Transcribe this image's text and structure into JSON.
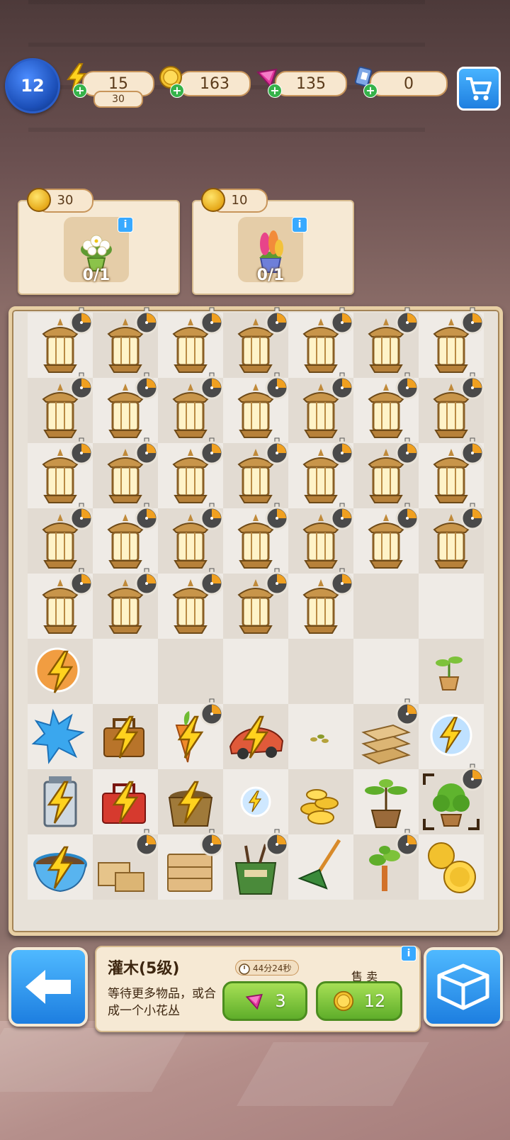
{
  "top_bar": {
    "level": "12",
    "energy": {
      "value": "15",
      "max": "30"
    },
    "coins": "163",
    "gems": "135",
    "cards": "0",
    "plus_symbol": "+",
    "shop_icon": "cart-icon"
  },
  "orders": [
    {
      "reward": "30",
      "item_icon": "white-flower-pot-icon",
      "progress": "0/1",
      "info": "i"
    },
    {
      "reward": "10",
      "item_icon": "hyacinth-pot-icon",
      "progress": "0/1",
      "info": "i"
    }
  ],
  "board": {
    "columns": 7,
    "rows": 9,
    "lantern_rows": [
      7,
      7,
      7,
      7,
      5
    ],
    "row6": [
      {
        "col": 0,
        "icon": "energy-bubble-orange-icon"
      },
      {
        "col": 6,
        "icon": "sprout-pot-icon"
      }
    ],
    "row7": [
      {
        "col": 0,
        "icon": "blue-splash-icon"
      },
      {
        "col": 1,
        "icon": "wooden-toolbox-energy-icon"
      },
      {
        "col": 2,
        "icon": "carrot-energy-icon",
        "timer": true
      },
      {
        "col": 3,
        "icon": "toy-car-energy-icon"
      },
      {
        "col": 4,
        "icon": "seeds-icon"
      },
      {
        "col": 5,
        "icon": "wooden-planks-icon",
        "timer": true
      },
      {
        "col": 6,
        "icon": "energy-bubble-blue-icon"
      }
    ],
    "row8": [
      {
        "col": 0,
        "icon": "lantern-glass-energy-icon"
      },
      {
        "col": 1,
        "icon": "red-toolbox-energy-icon"
      },
      {
        "col": 2,
        "icon": "bucket-energy-icon"
      },
      {
        "col": 3,
        "icon": "small-energy-bubble-icon"
      },
      {
        "col": 4,
        "icon": "gold-coins-pile-icon"
      },
      {
        "col": 5,
        "icon": "potted-plant-icon"
      },
      {
        "col": 6,
        "icon": "shrub-selected-icon",
        "timer": true
      }
    ],
    "row9": [
      {
        "col": 0,
        "icon": "soil-bowl-energy-icon"
      },
      {
        "col": 1,
        "icon": "wooden-crates-icon",
        "timer": true
      },
      {
        "col": 2,
        "icon": "wooden-dresser-icon",
        "timer": true
      },
      {
        "col": 3,
        "icon": "tool-bucket-icon",
        "timer": true
      },
      {
        "col": 4,
        "icon": "rake-icon"
      },
      {
        "col": 5,
        "icon": "sapling-icon",
        "timer": true
      },
      {
        "col": 6,
        "icon": "gold-coins-icon"
      }
    ]
  },
  "selected_item": {
    "name": "灌木(5级)",
    "description": "等待更多物品，或合成一个小花丛",
    "cooldown": "44分24秒",
    "gem_price": "3",
    "sell_label": "售 卖",
    "sell_price": "12",
    "info": "i"
  },
  "buttons": {
    "back_icon": "back-arrow-icon",
    "inventory_icon": "box-icon"
  },
  "colors": {
    "accent_blue": "#1f7fe0",
    "board_bg": "#e7e1d8",
    "panel_bg": "#f6e9d4",
    "green_button": "#5fae2a",
    "gold": "#e6a91a"
  }
}
